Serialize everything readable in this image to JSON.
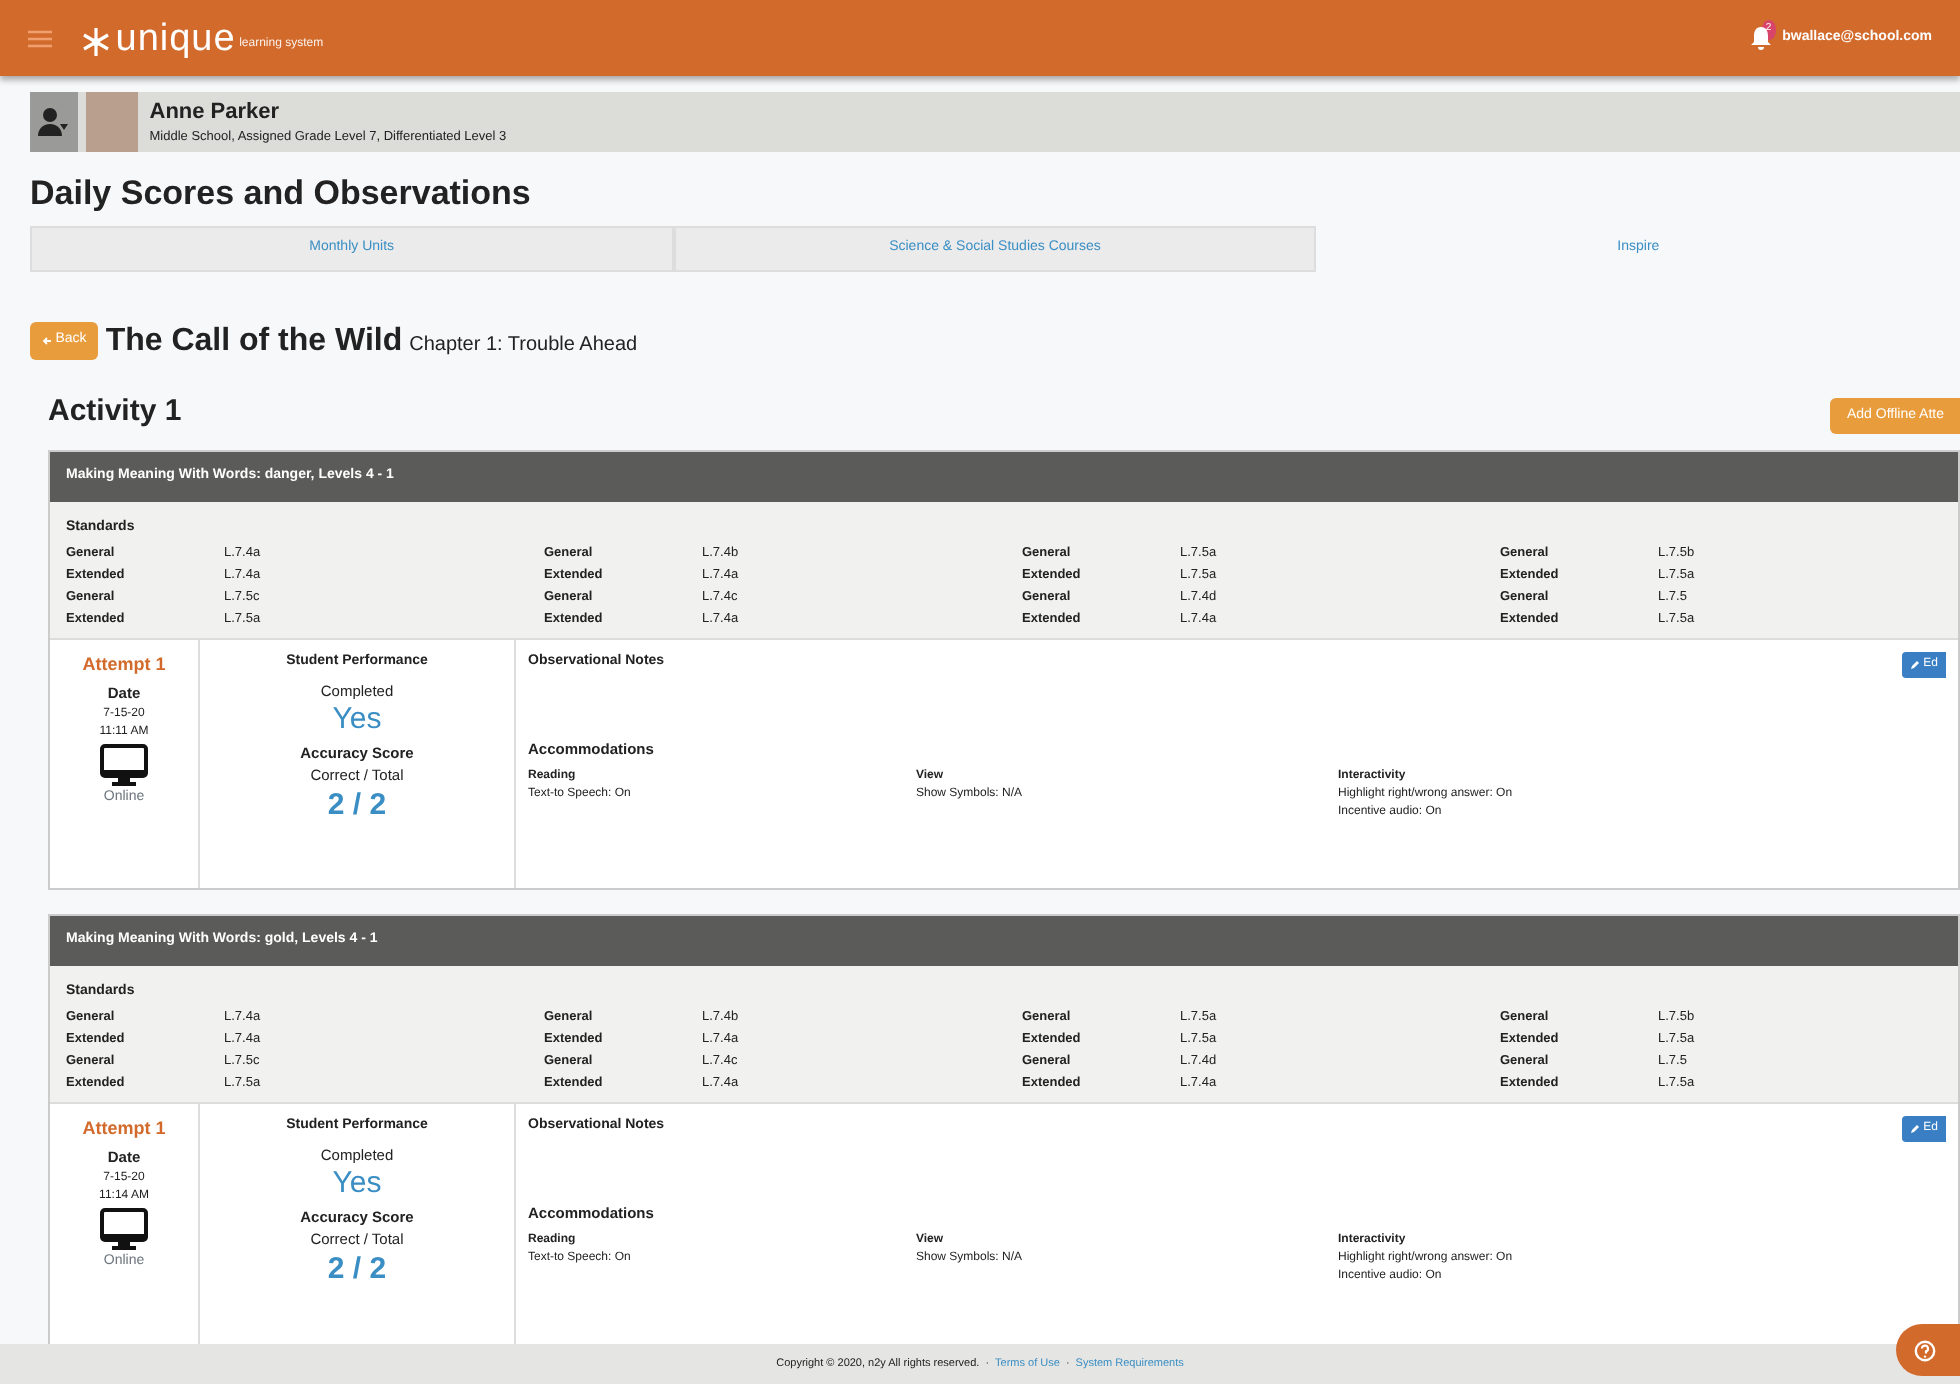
{
  "navbar": {
    "brand": "unique",
    "brand_sub": "learning system",
    "notifications": "2",
    "user": "bwallace@school.com"
  },
  "student": {
    "name": "Anne Parker",
    "details": "Middle School, Assigned Grade Level 7, Differentiated Level 3"
  },
  "page_title": "Daily Scores and Observations",
  "tabs": [
    {
      "label": "Monthly Units",
      "selected": false
    },
    {
      "label": "Science & Social Studies Courses",
      "selected": false
    },
    {
      "label": "Inspire",
      "selected": true
    }
  ],
  "back_button": "Back",
  "book_title": "The Call of the Wild",
  "chapter": "Chapter 1: Trouble Ahead",
  "activity_title": "Activity 1",
  "add_button": "Add Offline Atte",
  "sections": [
    {
      "title": "Making Meaning With Words: danger, Levels 4 - 1",
      "standards_label": "Standards",
      "standards": [
        [
          [
            "General",
            "L.7.4a"
          ],
          [
            "Extended",
            "L.7.4a"
          ],
          [
            "General",
            "L.7.5c"
          ],
          [
            "Extended",
            "L.7.5a"
          ]
        ],
        [
          [
            "General",
            "L.7.4b"
          ],
          [
            "Extended",
            "L.7.4a"
          ],
          [
            "General",
            "L.7.4c"
          ],
          [
            "Extended",
            "L.7.4a"
          ]
        ],
        [
          [
            "General",
            "L.7.5a"
          ],
          [
            "Extended",
            "L.7.5a"
          ],
          [
            "General",
            "L.7.4d"
          ],
          [
            "Extended",
            "L.7.4a"
          ]
        ],
        [
          [
            "General",
            "L.7.5b"
          ],
          [
            "Extended",
            "L.7.5a"
          ],
          [
            "General",
            "L.7.5"
          ],
          [
            "Extended",
            "L.7.5a"
          ]
        ]
      ],
      "attempt": {
        "label": "Attempt 1",
        "date_label": "Date",
        "date": "7-15-20",
        "time": "11:11 AM",
        "mode": "Online",
        "performance_title": "Student Performance",
        "completed_label": "Completed",
        "completed": "Yes",
        "score_label": "Accuracy Score",
        "score_sub": "Correct / Total",
        "score": "2 / 2",
        "notes_title": "Observational Notes",
        "edit": "Ed",
        "accommodations_title": "Accommodations",
        "accommodations": [
          {
            "heading": "Reading",
            "lines": [
              "Text-to Speech: On"
            ]
          },
          {
            "heading": "View",
            "lines": [
              "Show Symbols: N/A"
            ]
          },
          {
            "heading": "Interactivity",
            "lines": [
              "Highlight right/wrong answer: On",
              "Incentive audio: On"
            ]
          }
        ]
      }
    },
    {
      "title": "Making Meaning With Words: gold, Levels 4 - 1",
      "standards_label": "Standards",
      "standards": [
        [
          [
            "General",
            "L.7.4a"
          ],
          [
            "Extended",
            "L.7.4a"
          ],
          [
            "General",
            "L.7.5c"
          ],
          [
            "Extended",
            "L.7.5a"
          ]
        ],
        [
          [
            "General",
            "L.7.4b"
          ],
          [
            "Extended",
            "L.7.4a"
          ],
          [
            "General",
            "L.7.4c"
          ],
          [
            "Extended",
            "L.7.4a"
          ]
        ],
        [
          [
            "General",
            "L.7.5a"
          ],
          [
            "Extended",
            "L.7.5a"
          ],
          [
            "General",
            "L.7.4d"
          ],
          [
            "Extended",
            "L.7.4a"
          ]
        ],
        [
          [
            "General",
            "L.7.5b"
          ],
          [
            "Extended",
            "L.7.5a"
          ],
          [
            "General",
            "L.7.5"
          ],
          [
            "Extended",
            "L.7.5a"
          ]
        ]
      ],
      "attempt": {
        "label": "Attempt 1",
        "date_label": "Date",
        "date": "7-15-20",
        "time": "11:14 AM",
        "mode": "Online",
        "performance_title": "Student Performance",
        "completed_label": "Completed",
        "completed": "Yes",
        "score_label": "Accuracy Score",
        "score_sub": "Correct / Total",
        "score": "2 / 2",
        "notes_title": "Observational Notes",
        "edit": "Ed",
        "accommodations_title": "Accommodations",
        "accommodations": [
          {
            "heading": "Reading",
            "lines": [
              "Text-to Speech: On"
            ]
          },
          {
            "heading": "View",
            "lines": [
              "Show Symbols: N/A"
            ]
          },
          {
            "heading": "Interactivity",
            "lines": [
              "Highlight right/wrong answer: On",
              "Incentive audio: On"
            ]
          }
        ]
      }
    }
  ],
  "footer": {
    "copyright": "Copyright © 2020, n2y All rights reserved.",
    "separator": "·",
    "links": [
      "Terms of Use",
      "System Requirements"
    ]
  }
}
